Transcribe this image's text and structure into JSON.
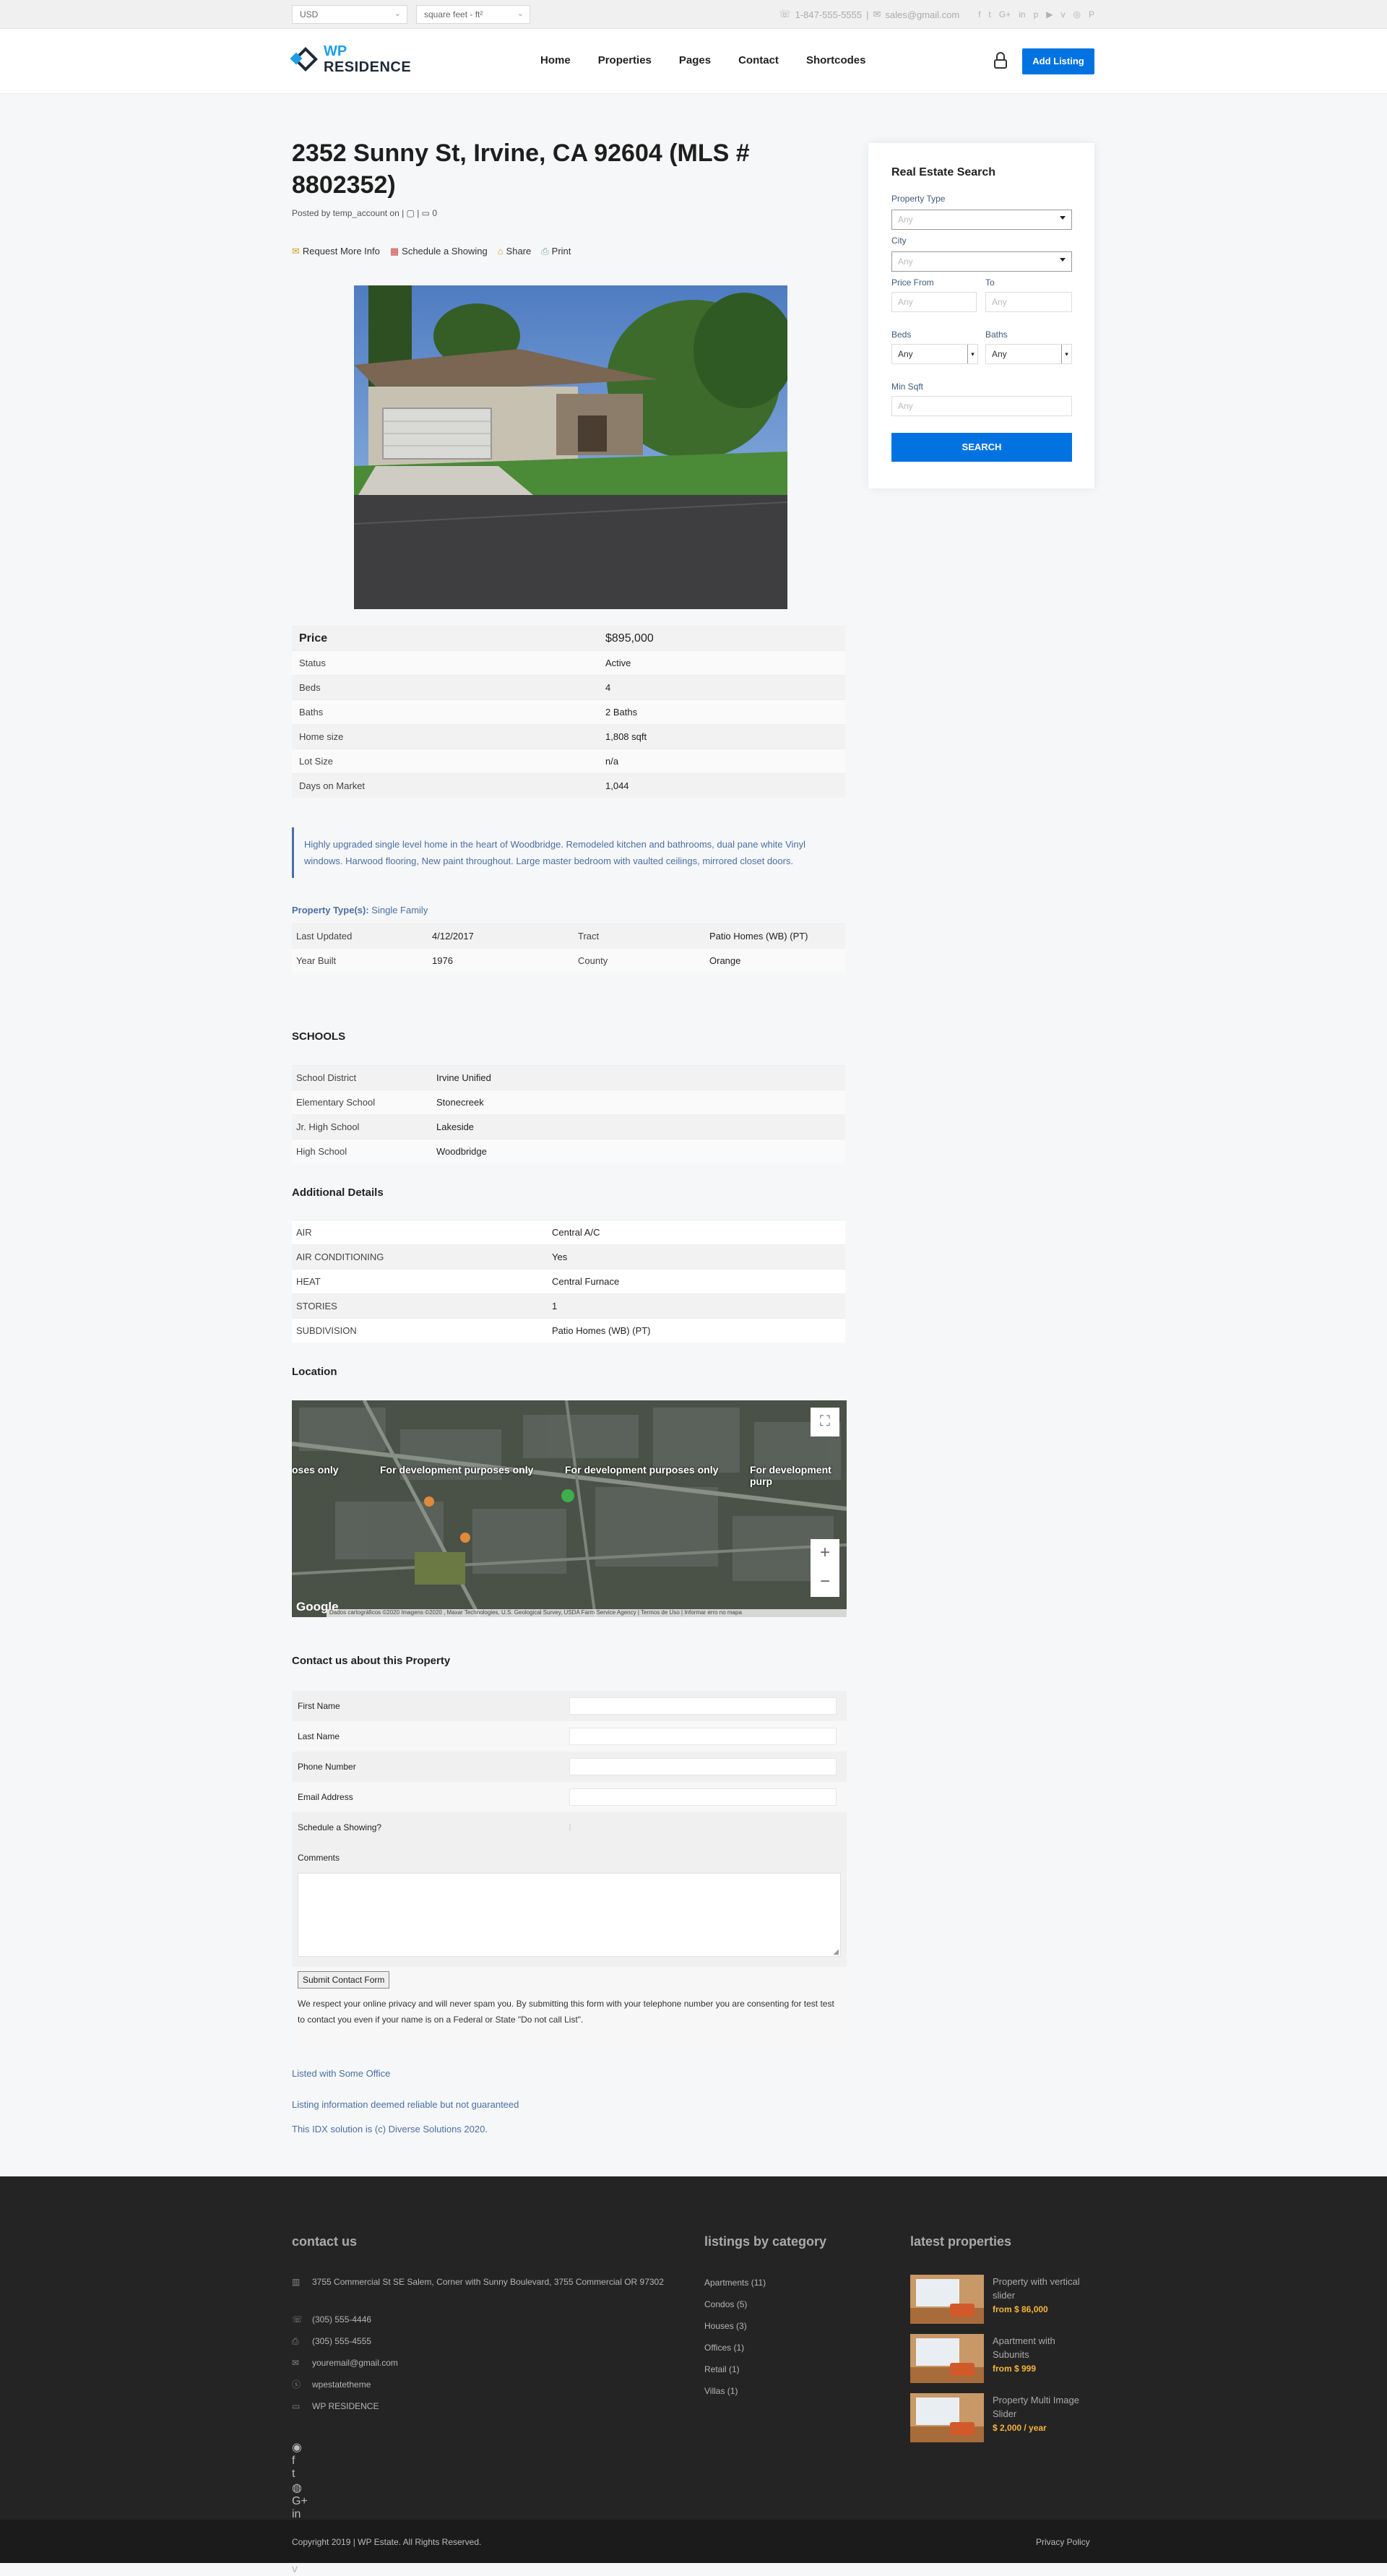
{
  "topbar": {
    "currency": "USD",
    "unit": "square feet - ft²",
    "phone": "1-847-555-5555",
    "separator": "|",
    "email": "sales@gmail.com",
    "social_icons": [
      "f",
      "t",
      "G+",
      "in",
      "p",
      "▶",
      "v",
      "◎",
      "P"
    ]
  },
  "header": {
    "logo_wp": "WP",
    "logo_res": "RESIDENCE",
    "nav": [
      "Home",
      "Properties",
      "Pages",
      "Contact",
      "Shortcodes"
    ],
    "add_listing": "Add Listing"
  },
  "property": {
    "title": "2352 Sunny St, Irvine, CA 92604 (MLS # 8802352)",
    "posted": "Posted by temp_account on | ▢ | ▭ 0",
    "actions": [
      {
        "icon": "✉",
        "label": "Request More Info"
      },
      {
        "icon": "▦",
        "label": "Schedule a Showing"
      },
      {
        "icon": "⌂",
        "label": "Share"
      },
      {
        "icon": "⎙",
        "label": "Print"
      }
    ],
    "summary": [
      {
        "k": "Price",
        "v": "$895,000"
      },
      {
        "k": "Status",
        "v": "Active"
      },
      {
        "k": "Beds",
        "v": "4"
      },
      {
        "k": "Baths",
        "v": "2 Baths"
      },
      {
        "k": "Home size",
        "v": "1,808 sqft"
      },
      {
        "k": "Lot Size",
        "v": "n/a"
      },
      {
        "k": "Days on Market",
        "v": "1,044"
      }
    ],
    "description": "Highly upgraded single level home in the heart of Woodbridge. Remodeled kitchen and bathrooms, dual pane white Vinyl windows. Harwood flooring, New paint throughout. Large master bedroom with vaulted ceilings, mirrored closet doors.",
    "ptype_label": "Property Type(s):",
    "ptype_value": "Single Family",
    "details": [
      {
        "k1": "Last Updated",
        "v1": "4/12/2017",
        "k2": "Tract",
        "v2": "Patio Homes (WB) (PT)"
      },
      {
        "k1": "Year Built",
        "v1": "1976",
        "k2": "County",
        "v2": "Orange"
      }
    ],
    "schools_title": "SCHOOLS",
    "schools": [
      {
        "k": "School District",
        "v": "Irvine Unified"
      },
      {
        "k": "Elementary School",
        "v": "Stonecreek"
      },
      {
        "k": "Jr. High School",
        "v": "Lakeside"
      },
      {
        "k": "High School",
        "v": "Woodbridge"
      }
    ],
    "additional_title": "Additional Details",
    "additional": [
      {
        "k": "AIR",
        "v": "Central A/C"
      },
      {
        "k": "AIR CONDITIONING",
        "v": "Yes"
      },
      {
        "k": "HEAT",
        "v": "Central Furnace"
      },
      {
        "k": "STORIES",
        "v": "1"
      },
      {
        "k": "SUBDIVISION",
        "v": "Patio Homes (WB) (PT)"
      }
    ],
    "location_title": "Location",
    "map": {
      "dev": [
        "oses only",
        "For development purposes only",
        "For development purposes only",
        "For development purp"
      ],
      "google": "Google",
      "attribution": "Dados cartográficos ©2020 Imagens ©2020 , Maxar Technologies, U.S. Geological Survey, USDA Farm Service Agency",
      "terms": "Termos de Uso",
      "report": "Informar erro no mapa",
      "zoom_in": "+",
      "zoom_out": "−",
      "fullscreen": "⛶"
    },
    "contact_title": "Contact us about this Property",
    "form": {
      "first": "First Name",
      "last": "Last Name",
      "phone": "Phone Number",
      "email": "Email Address",
      "showing": "Schedule a Showing?",
      "comments": "Comments",
      "submit": "Submit Contact Form",
      "privacy": "We respect your online privacy and will never spam you. By submitting this form with your telephone number you are consenting for test test to contact you even if your name is on a Federal or State \"Do not call List\"."
    },
    "listed": "Listed with Some Office",
    "reliable": "Listing information deemed reliable but not guaranteed",
    "idx": "This IDX solution is (c) Diverse Solutions 2020."
  },
  "sidebar": {
    "title": "Real Estate Search",
    "property_type": "Property Type",
    "city": "City",
    "any": "Any",
    "price_from": "Price From",
    "to": "To",
    "beds": "Beds",
    "baths": "Baths",
    "min_sqft": "Min Sqft",
    "search": "SEARCH"
  },
  "footer": {
    "contact_title": "contact us",
    "address": "3755 Commercial St SE Salem, Corner with Sunny Boulevard, 3755 Commercial OR 97302",
    "phone1": "(305) 555-4446",
    "phone2": "(305) 555-4555",
    "email": "youremail@gmail.com",
    "skype": "wpestatetheme",
    "site": "WP RESIDENCE",
    "cat_title": "listings by category",
    "categories": [
      "Apartments (11)",
      "Condos (5)",
      "Houses (3)",
      "Offices (1)",
      "Retail (1)",
      "Villas (1)"
    ],
    "latest_title": "latest properties",
    "latest": [
      {
        "title": "Property with vertical slider",
        "price": "from $ 86,000"
      },
      {
        "title": "Apartment with Subunits",
        "price": "from $ 999"
      },
      {
        "title": "Property Multi Image Slider",
        "price": "$ 2,000 / year"
      }
    ],
    "social": [
      "◉",
      "f",
      "t",
      "◍",
      "G+",
      "in",
      "t",
      "◎",
      "▶",
      "v"
    ],
    "copyright": "Copyright 2019 | WP Estate. All Rights Reserved.",
    "privacy": "Privacy Policy"
  }
}
